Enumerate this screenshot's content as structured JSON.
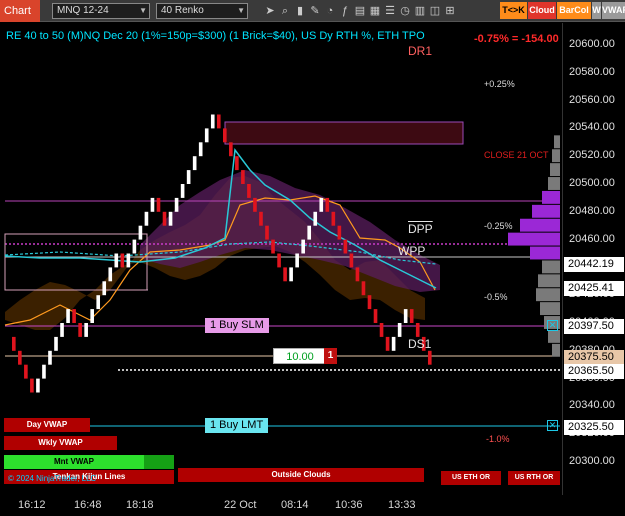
{
  "toolbar": {
    "chart_tag": "Chart",
    "instrument": "MNQ 12-24",
    "bar_type": "40 Renko",
    "buttons": [
      {
        "label": "T<>K",
        "bg": "#ff8c1a",
        "fg": "#000000"
      },
      {
        "label": "Cloud",
        "bg": "#e0352b",
        "fg": "#ffffff"
      },
      {
        "label": "BarCol",
        "bg": "#ff8c1a",
        "fg": "#ffffff"
      },
      {
        "label": "W",
        "bg": "#9a9a9a",
        "fg": "#ffffff"
      },
      {
        "label": "VWAP",
        "bg": "#9a9a9a",
        "fg": "#ffffff"
      }
    ],
    "icons": [
      "cursor-icon",
      "magnifier-icon",
      "bar-style-icon",
      "drawing-tool-icon",
      "bubble-icon",
      "indicator-icon",
      "template-icon",
      "grid-icon",
      "properties-icon",
      "time-icon",
      "chart-icon",
      "data-icon",
      "link-icon"
    ]
  },
  "chart": {
    "title": "RE 40 to 50 (M)NQ Dec 20 (1%=150p=$300) (1 Brick=$40), US Dy RTH %, ETH TPO",
    "pnl": "-0.75% = -154.00",
    "labels": {
      "dr1": "DR1",
      "plus025": "+0.25%",
      "close21oct": "CLOSE 21 OCT",
      "minus025": "-0.25%",
      "dpp": "DPP",
      "wpp": "WPP",
      "minus05": "-0.5%",
      "ds1": "DS1",
      "minus10": "-1.0%"
    },
    "orders": {
      "buy_slm": "1 Buy SLM",
      "buy_lmt": "1 Buy LMT",
      "qty_value": "10.00",
      "qty_count": "1"
    }
  },
  "price_axis": {
    "ticks": [
      "20600.00",
      "20580.00",
      "20560.00",
      "20540.00",
      "20520.00",
      "20500.00",
      "20480.00",
      "20460.00",
      "20440.00",
      "20420.00",
      "20400.00",
      "20380.00",
      "20360.00",
      "20340.00",
      "20320.00",
      "20300.00"
    ],
    "tags": [
      {
        "label": "20442.19",
        "bg": "#ffffff"
      },
      {
        "label": "20425.41",
        "bg": "#ffffff"
      },
      {
        "label": "20397.50",
        "bg": "#ffffff"
      },
      {
        "label": "20375.50",
        "bg": "#e8c7a8"
      },
      {
        "label": "20365.50",
        "bg": "#ffffff"
      },
      {
        "label": "20325.50",
        "bg": "#ffffff"
      }
    ]
  },
  "time_axis": [
    "16:12",
    "16:48",
    "18:18",
    "22 Oct",
    "08:14",
    "10:36",
    "13:33"
  ],
  "panels": {
    "day_vwap": "Day VWAP",
    "wkly_vwap": "Wkly VWAP",
    "mnt_vwap": "Mnt VWAP",
    "tenkan": "Tenkan Kijun Lines",
    "outside_clouds": "Outside Clouds",
    "us_eth_or": "US ETH OR",
    "us_rth_or": "US RTH OR",
    "copyright": "© 2024 NinjaTrader, LLC"
  },
  "colors": {
    "up_brick": "#ffffff",
    "down_brick": "#e0141e",
    "tenkan": "#29c8d6",
    "kijun": "#ff9a1f",
    "cloud_purple": "#5a1d5e",
    "cloud_orange": "#6b3a00",
    "volume_profile": "#9b28d6"
  },
  "chart_data": {
    "type": "renko",
    "brick_size": 10,
    "price_range": [
      20290,
      20615
    ],
    "bricks": [
      {
        "open": 20390,
        "close": 20380
      },
      {
        "open": 20380,
        "close": 20370
      },
      {
        "open": 20370,
        "close": 20360
      },
      {
        "open": 20360,
        "close": 20350
      },
      {
        "open": 20350,
        "close": 20360
      },
      {
        "open": 20360,
        "close": 20370
      },
      {
        "open": 20370,
        "close": 20380
      },
      {
        "open": 20380,
        "close": 20390
      },
      {
        "open": 20390,
        "close": 20400
      },
      {
        "open": 20400,
        "close": 20410
      },
      {
        "open": 20410,
        "close": 20400
      },
      {
        "open": 20400,
        "close": 20390
      },
      {
        "open": 20390,
        "close": 20400
      },
      {
        "open": 20400,
        "close": 20410
      },
      {
        "open": 20410,
        "close": 20420
      },
      {
        "open": 20420,
        "close": 20430
      },
      {
        "open": 20430,
        "close": 20440
      },
      {
        "open": 20440,
        "close": 20450
      },
      {
        "open": 20450,
        "close": 20440
      },
      {
        "open": 20440,
        "close": 20450
      },
      {
        "open": 20450,
        "close": 20460
      },
      {
        "open": 20460,
        "close": 20470
      },
      {
        "open": 20470,
        "close": 20480
      },
      {
        "open": 20480,
        "close": 20490
      },
      {
        "open": 20490,
        "close": 20480
      },
      {
        "open": 20480,
        "close": 20470
      },
      {
        "open": 20470,
        "close": 20480
      },
      {
        "open": 20480,
        "close": 20490
      },
      {
        "open": 20490,
        "close": 20500
      },
      {
        "open": 20500,
        "close": 20510
      },
      {
        "open": 20510,
        "close": 20520
      },
      {
        "open": 20520,
        "close": 20530
      },
      {
        "open": 20530,
        "close": 20540
      },
      {
        "open": 20540,
        "close": 20550
      },
      {
        "open": 20550,
        "close": 20540
      },
      {
        "open": 20540,
        "close": 20530
      },
      {
        "open": 20530,
        "close": 20520
      },
      {
        "open": 20520,
        "close": 20510
      },
      {
        "open": 20510,
        "close": 20500
      },
      {
        "open": 20500,
        "close": 20490
      },
      {
        "open": 20490,
        "close": 20480
      },
      {
        "open": 20480,
        "close": 20470
      },
      {
        "open": 20470,
        "close": 20460
      },
      {
        "open": 20460,
        "close": 20450
      },
      {
        "open": 20450,
        "close": 20440
      },
      {
        "open": 20440,
        "close": 20430
      },
      {
        "open": 20430,
        "close": 20440
      },
      {
        "open": 20440,
        "close": 20450
      },
      {
        "open": 20450,
        "close": 20460
      },
      {
        "open": 20460,
        "close": 20470
      },
      {
        "open": 20470,
        "close": 20480
      },
      {
        "open": 20480,
        "close": 20490
      },
      {
        "open": 20490,
        "close": 20480
      },
      {
        "open": 20480,
        "close": 20470
      },
      {
        "open": 20470,
        "close": 20460
      },
      {
        "open": 20460,
        "close": 20450
      },
      {
        "open": 20450,
        "close": 20440
      },
      {
        "open": 20440,
        "close": 20430
      },
      {
        "open": 20430,
        "close": 20420
      },
      {
        "open": 20420,
        "close": 20410
      },
      {
        "open": 20410,
        "close": 20400
      },
      {
        "open": 20400,
        "close": 20390
      },
      {
        "open": 20390,
        "close": 20380
      },
      {
        "open": 20380,
        "close": 20390
      },
      {
        "open": 20390,
        "close": 20400
      },
      {
        "open": 20400,
        "close": 20410
      },
      {
        "open": 20410,
        "close": 20400
      },
      {
        "open": 20400,
        "close": 20390
      },
      {
        "open": 20390,
        "close": 20380
      },
      {
        "open": 20380,
        "close": 20370
      }
    ]
  }
}
